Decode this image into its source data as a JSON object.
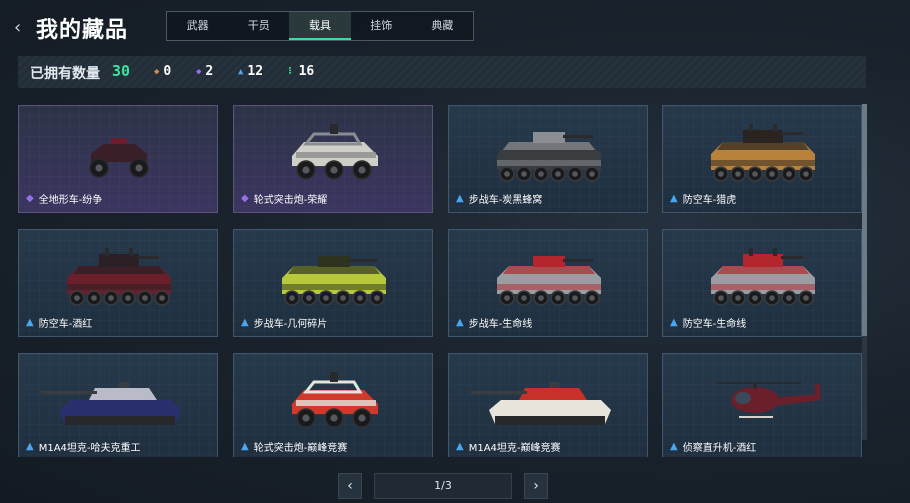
{
  "header": {
    "back_icon": "chevron-left-icon",
    "title": "我的藏品"
  },
  "tabs": [
    {
      "label": "武器",
      "active": false
    },
    {
      "label": "干员",
      "active": false
    },
    {
      "label": "载具",
      "active": true
    },
    {
      "label": "挂饰",
      "active": false
    },
    {
      "label": "典藏",
      "active": false
    }
  ],
  "owned": {
    "label": "已拥有数量",
    "total": "30",
    "stats": [
      {
        "icon": "orange-diamond-icon",
        "color": "#e0893a",
        "value": "0"
      },
      {
        "icon": "purple-diamond-icon",
        "color": "#9a6cf0",
        "value": "2"
      },
      {
        "icon": "blue-chevron-icon",
        "color": "#4aa6ee",
        "value": "12"
      },
      {
        "icon": "green-dots-icon",
        "color": "#3bd69a",
        "value": "16"
      }
    ]
  },
  "items": [
    {
      "name": "全地形车-纷争",
      "rarity": "epic",
      "vehicle": "atv",
      "colors": [
        "#3a1f28",
        "#6e1e2a"
      ]
    },
    {
      "name": "轮式突击炮-荣耀",
      "rarity": "epic",
      "vehicle": "buggy",
      "colors": [
        "#cfcfc8",
        "#8a8d8f"
      ]
    },
    {
      "name": "步战车-炭黑蜂窝",
      "rarity": "rare",
      "vehicle": "apc",
      "colors": [
        "#3a3d40",
        "#8b8f93"
      ]
    },
    {
      "name": "防空车-猎虎",
      "rarity": "rare",
      "vehicle": "apc-aa",
      "colors": [
        "#b8823a",
        "#2a2420"
      ]
    },
    {
      "name": "防空车-酒红",
      "rarity": "rare",
      "vehicle": "apc-aa",
      "colors": [
        "#6a1f2a",
        "#2a2025"
      ]
    },
    {
      "name": "步战车-几何碎片",
      "rarity": "rare",
      "vehicle": "apc",
      "colors": [
        "#b7c93a",
        "#2e3320"
      ]
    },
    {
      "name": "步战车-生命线",
      "rarity": "rare",
      "vehicle": "apc",
      "colors": [
        "#9a9ea2",
        "#b3262e"
      ]
    },
    {
      "name": "防空车-生命线",
      "rarity": "rare",
      "vehicle": "apc-aa",
      "colors": [
        "#9a9ea2",
        "#b3262e"
      ]
    },
    {
      "name": "M1A4坦克-哈夫克重工",
      "rarity": "rare",
      "vehicle": "tank",
      "colors": [
        "#2a2f6e",
        "#b9bcc8"
      ]
    },
    {
      "name": "轮式突击炮-巅峰竞赛",
      "rarity": "rare",
      "vehicle": "buggy",
      "colors": [
        "#d13a2a",
        "#e8e4dc"
      ]
    },
    {
      "name": "M1A4坦克-巅峰竞赛",
      "rarity": "rare",
      "vehicle": "tank",
      "colors": [
        "#e8e4dc",
        "#c8302a"
      ]
    },
    {
      "name": "侦察直升机-酒红",
      "rarity": "rare",
      "vehicle": "heli",
      "colors": [
        "#6a1f2a",
        "#d8d2cc"
      ]
    }
  ],
  "pagination": {
    "prev_icon": "chevron-left-icon",
    "next_icon": "chevron-right-icon",
    "indicator": "1/3"
  },
  "scroll_fraction": 0.69
}
